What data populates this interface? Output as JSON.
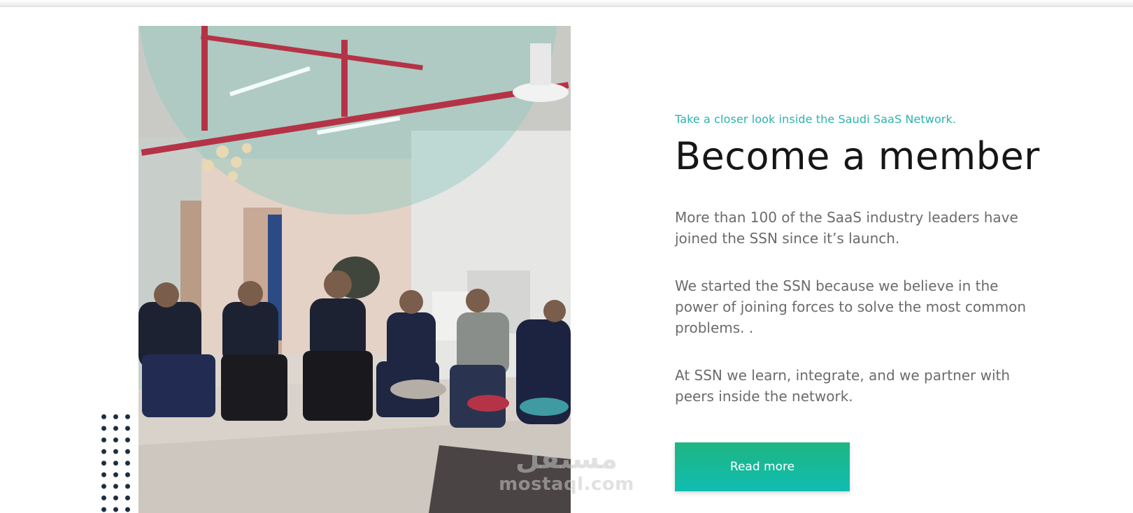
{
  "section": {
    "eyebrow": "Take a closer look inside the Saudi SaaS Network.",
    "title": "Become a member",
    "paragraphs": [
      "More than 100 of the SaaS industry leaders have joined the SSN since it’s launch.",
      "We started the SSN because we believe in the power of joining forces to solve the most common problems. .",
      "At SSN we learn, integrate, and we partner with peers inside the network."
    ],
    "cta_label": "Read more"
  },
  "watermark": {
    "arabic": "مستقل",
    "latin": "mostaql.com"
  },
  "colors": {
    "accent": "#2ab3ad",
    "button_top": "#1fb582",
    "button_bottom": "#0fbdb0",
    "dots": "#1c2e3f"
  },
  "icons": [
    "dot-grid-decoration"
  ]
}
